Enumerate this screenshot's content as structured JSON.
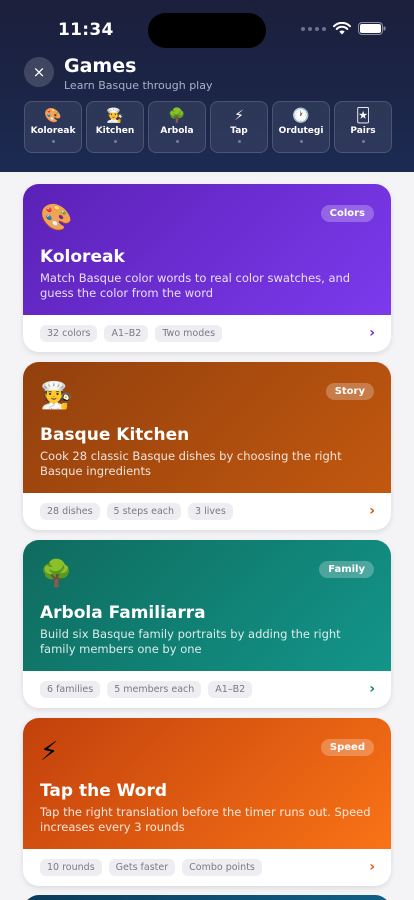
{
  "status": {
    "time": "11:34"
  },
  "header": {
    "close_label": "×",
    "title": "Games",
    "subtitle": "Learn Basque through play"
  },
  "tabs": [
    {
      "emoji": "🎨",
      "label": "Koloreak"
    },
    {
      "emoji": "🧑‍🍳",
      "label": "Kitchen"
    },
    {
      "emoji": "🌳",
      "label": "Arbola"
    },
    {
      "emoji": "⚡",
      "label": "Tap"
    },
    {
      "emoji": "🕐",
      "label": "Ordutegi"
    },
    {
      "emoji": "🃏",
      "label": "Pairs"
    }
  ],
  "cards": [
    {
      "emoji": "🎨",
      "badge": "Colors",
      "title": "Koloreak",
      "description": "Match Basque color words to real color swatches, and guess the color from the word",
      "chips": [
        "32 colors",
        "A1–B2",
        "Two modes"
      ],
      "chevron": "›",
      "accent": "#6d28d9"
    },
    {
      "emoji": "🧑‍🍳",
      "badge": "Story",
      "title": "Basque Kitchen",
      "description": "Cook 28 classic Basque dishes by choosing the right Basque ingredients",
      "chips": [
        "28 dishes",
        "5 steps each",
        "3 lives"
      ],
      "chevron": "›",
      "accent": "#c2580f"
    },
    {
      "emoji": "🌳",
      "badge": "Family",
      "title": "Arbola Familiarra",
      "description": "Build six Basque family portraits by adding the right family members one by one",
      "chips": [
        "6 families",
        "5 members each",
        "A1–B2"
      ],
      "chevron": "›",
      "accent": "#0f7c70"
    },
    {
      "emoji": "⚡",
      "badge": "Speed",
      "title": "Tap the Word",
      "description": "Tap the right translation before the timer runs out. Speed increases every 3 rounds",
      "chips": [
        "10 rounds",
        "Gets faster",
        "Combo points"
      ],
      "chevron": "›",
      "accent": "#ea580c"
    }
  ]
}
